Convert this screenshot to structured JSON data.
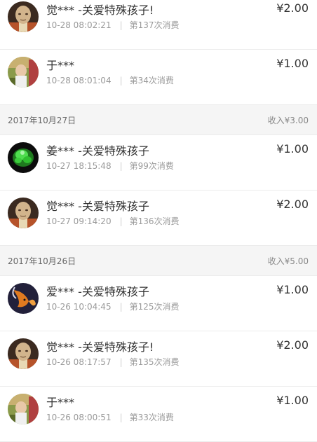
{
  "entries": [
    {
      "type": "txn",
      "name": "觉*** -关爱特殊孩子!",
      "time": "10-28 08:02:21",
      "count": "第137次消费",
      "amount": "¥2.00",
      "avatar": "monk-avatar-icon"
    },
    {
      "type": "txn",
      "name": "于***",
      "time": "10-28 08:01:04",
      "count": "第34次消费",
      "amount": "¥1.00",
      "avatar": "child-photo-avatar-icon"
    },
    {
      "type": "day",
      "date": "2017年10月27日",
      "total": "收入¥3.00"
    },
    {
      "type": "txn",
      "name": "姜*** -关爱特殊孩子",
      "time": "10-27 18:15:48",
      "count": "第99次消费",
      "amount": "¥1.00",
      "avatar": "green-plant-avatar-icon"
    },
    {
      "type": "txn",
      "name": "觉*** -关爱特殊孩子",
      "time": "10-27 09:14:20",
      "count": "第136次消费",
      "amount": "¥2.00",
      "avatar": "monk-avatar-icon"
    },
    {
      "type": "day",
      "date": "2017年10月26日",
      "total": "收入¥5.00"
    },
    {
      "type": "txn",
      "name": "爱*** -关爱特殊孩子",
      "time": "10-26 10:04:45",
      "count": "第125次消费",
      "amount": "¥1.00",
      "avatar": "goldfish-avatar-icon"
    },
    {
      "type": "txn",
      "name": "觉*** -关爱特殊孩子!",
      "time": "10-26 08:17:57",
      "count": "第135次消费",
      "amount": "¥2.00",
      "avatar": "monk-avatar-icon"
    },
    {
      "type": "txn",
      "name": "于***",
      "time": "10-26 08:00:51",
      "count": "第33次消费",
      "amount": "¥1.00",
      "avatar": "child-photo-avatar-icon"
    }
  ],
  "meta_separator": "|"
}
